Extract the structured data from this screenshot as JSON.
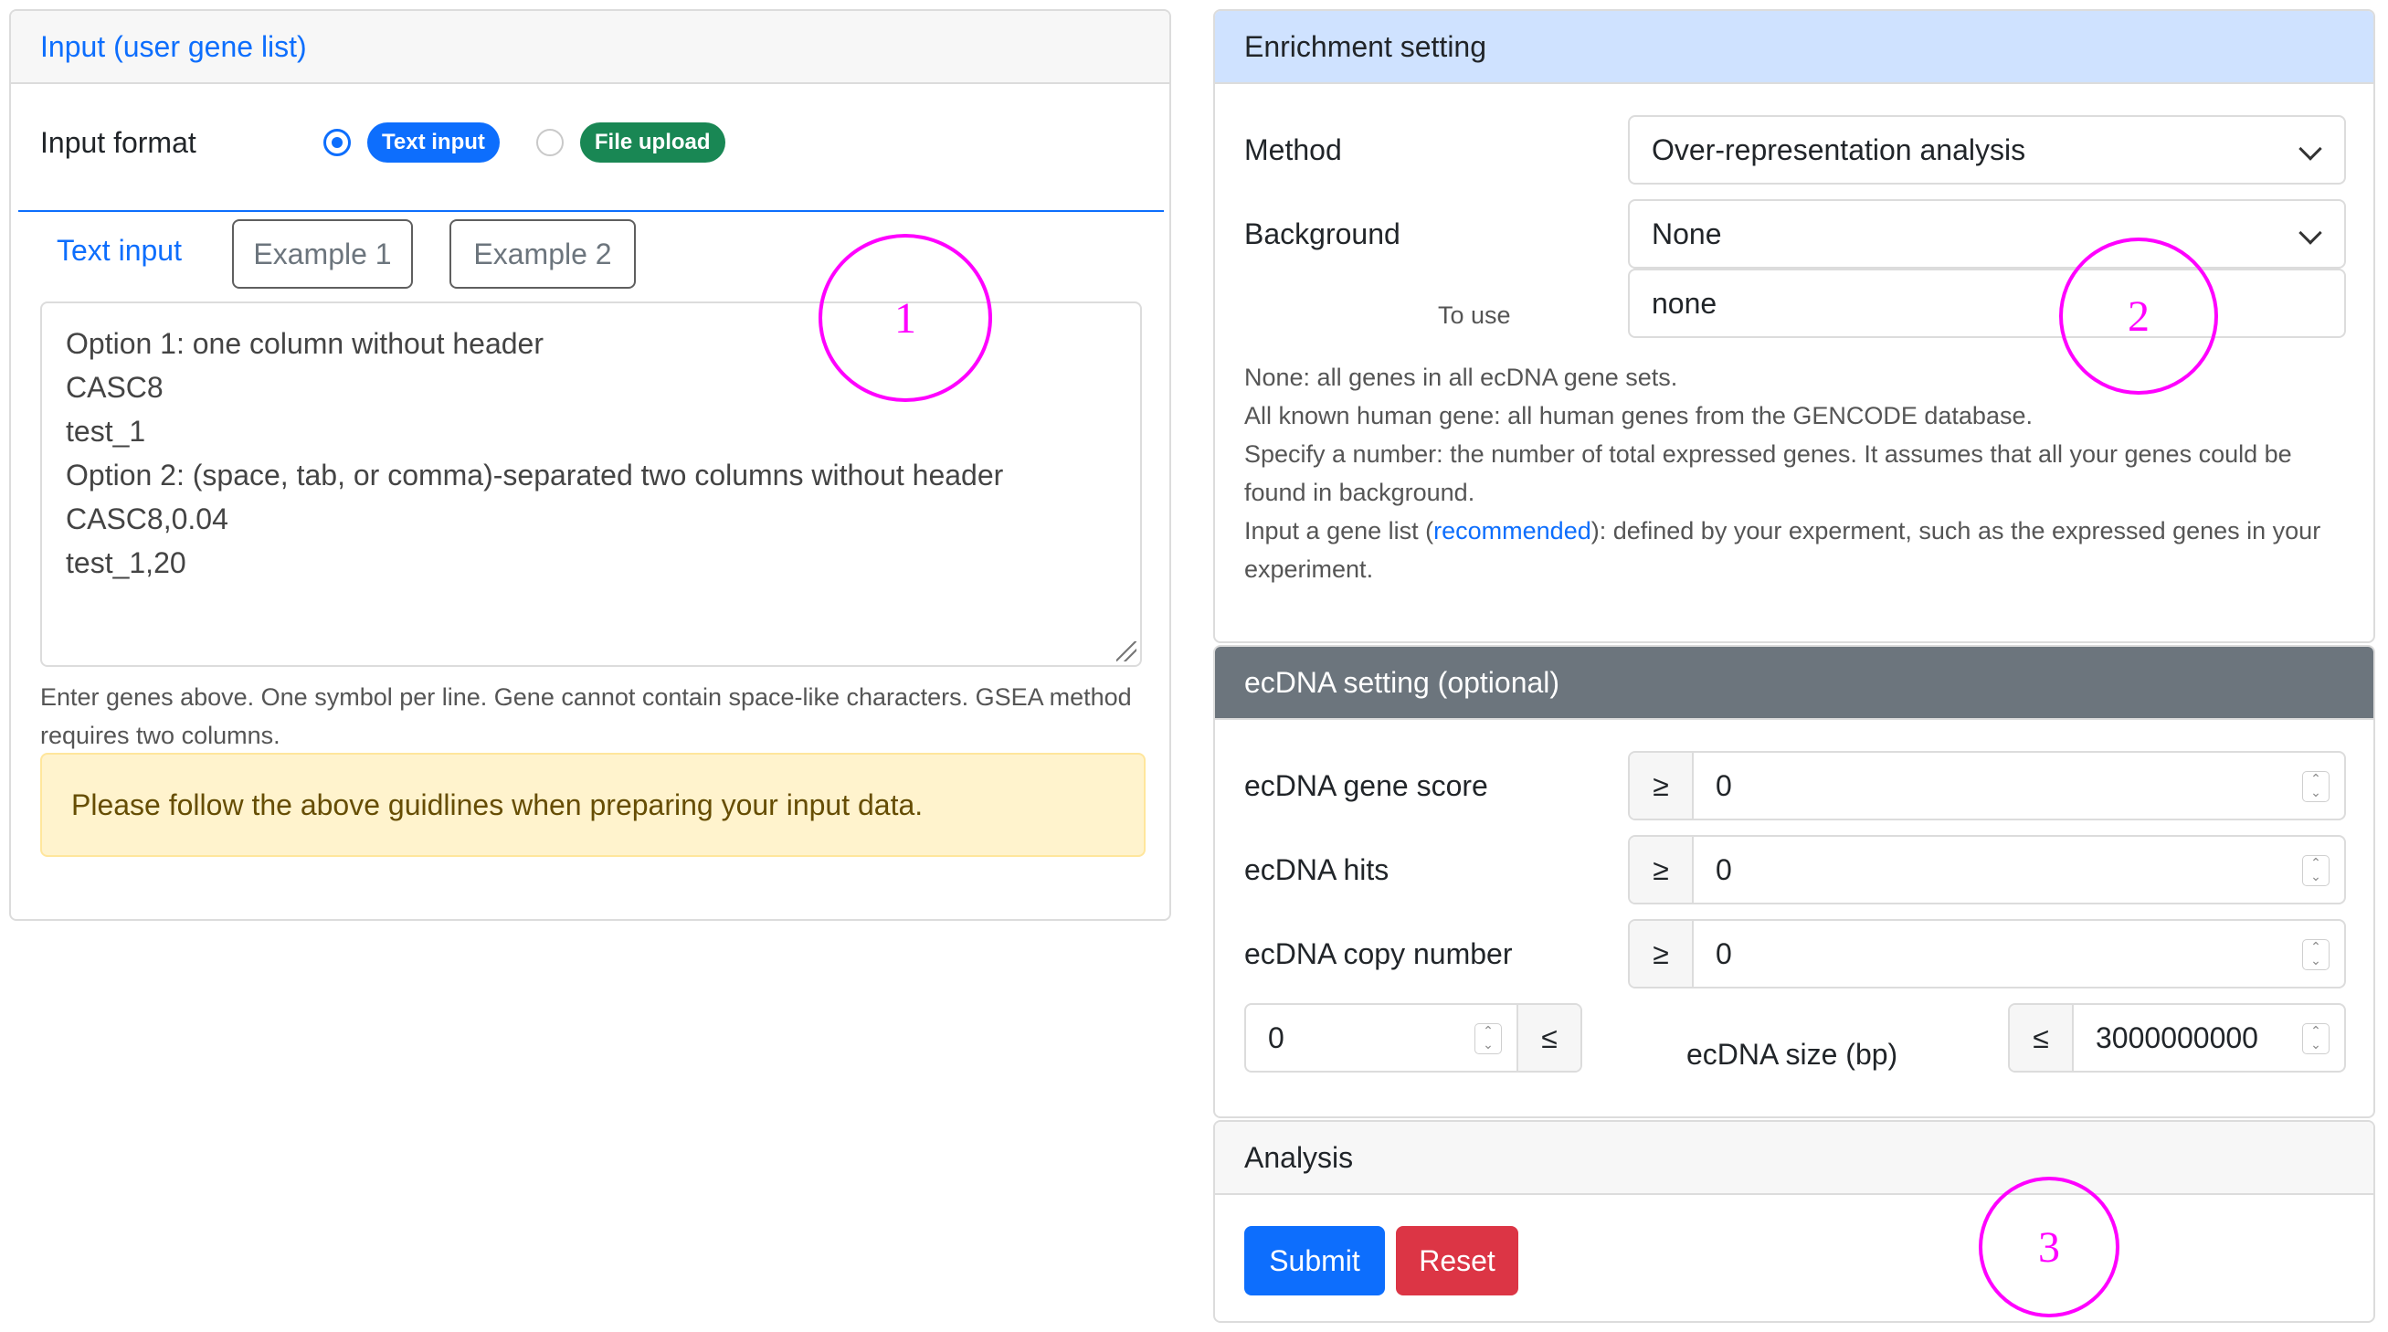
{
  "input_card": {
    "header": "Input (user gene list)",
    "format_label": "Input format",
    "format_options": [
      {
        "label": "Text input",
        "selected": true,
        "color": "#0d6efd"
      },
      {
        "label": "File upload",
        "selected": false,
        "color": "#198754"
      }
    ],
    "tab_active": "Text input",
    "example_buttons": [
      "Example 1",
      "Example 2"
    ],
    "textarea_lines": [
      "Option 1: one column without header",
      "CASC8",
      "test_1",
      "Option 2: (space, tab, or comma)-separated two columns without header",
      "CASC8,0.04",
      "test_1,20"
    ],
    "help_text": "Enter genes above. One symbol per line. Gene cannot contain space-like characters. GSEA method requires two columns.",
    "alert_text": "Please follow the above guidlines when preparing your input data."
  },
  "enrichment_card": {
    "header": "Enrichment setting",
    "method_label": "Method",
    "method_value": "Over-representation analysis",
    "background_label": "Background",
    "background_value": "None",
    "to_use_label": "To use",
    "to_use_value": "none",
    "desc": {
      "line1": "None: all genes in all ecDNA gene sets.",
      "line2": "All known human gene: all human genes from the GENCODE database.",
      "line3": "Specify a number: the number of total expressed genes. It assumes that all your genes could be found in background.",
      "line4_pre": "Input a gene list (",
      "line4_link": "recommended",
      "line4_post": "): defined by your experment, such as the expressed genes in your experiment."
    }
  },
  "ecdna_card": {
    "header": "ecDNA setting (optional)",
    "gene_score_label": "ecDNA gene score",
    "gene_score_value": "0",
    "hits_label": "ecDNA hits",
    "hits_value": "0",
    "copy_number_label": "ecDNA copy number",
    "copy_number_value": "0",
    "ge_symbol": "≥",
    "le_symbol": "≤",
    "size_label": "ecDNA size (bp)",
    "size_min_value": "0",
    "size_max_value": "3000000000"
  },
  "analysis_card": {
    "header": "Analysis",
    "submit_label": "Submit",
    "reset_label": "Reset",
    "submit_color": "#0d6efd",
    "reset_color": "#dc3545"
  },
  "annotations": [
    "1",
    "2",
    "3"
  ],
  "icons": {
    "select": "chevron-down-icon",
    "spinner": "spinner-arrows-icon",
    "resize": "resize-grip-icon"
  }
}
